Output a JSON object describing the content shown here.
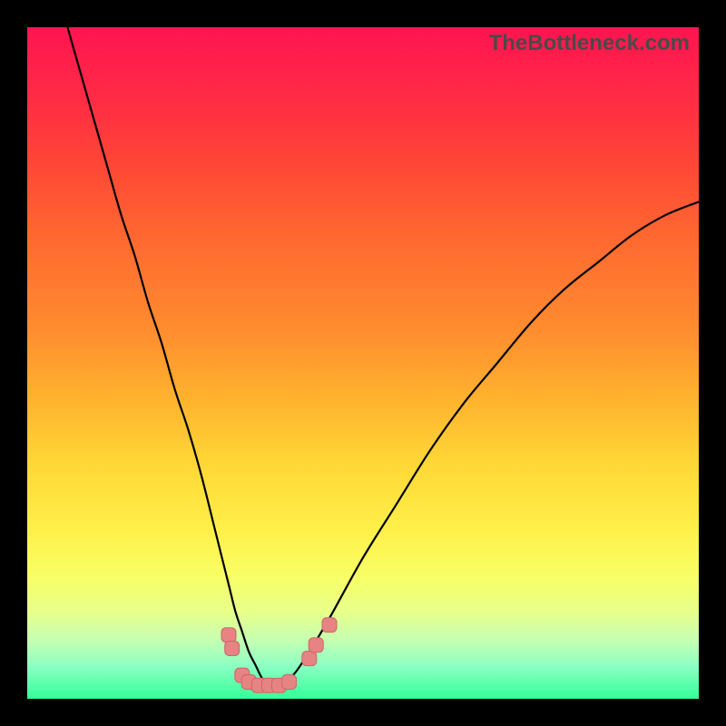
{
  "watermark": "TheBottleneck.com",
  "colors": {
    "frame": "#000000",
    "curve": "#000000",
    "marker_fill": "#e78383",
    "marker_stroke": "#c96868"
  },
  "chart_data": {
    "type": "line",
    "title": "",
    "xlabel": "",
    "ylabel": "",
    "xlim": [
      0,
      100
    ],
    "ylim": [
      0,
      100
    ],
    "series": [
      {
        "name": "bottleneck-curve",
        "x": [
          6,
          8,
          10,
          12,
          14,
          16,
          18,
          20,
          22,
          24,
          26,
          28,
          29,
          30,
          31,
          32,
          33,
          34,
          35,
          36,
          37,
          38,
          39,
          40,
          42,
          45,
          50,
          55,
          60,
          65,
          70,
          75,
          80,
          85,
          90,
          95,
          100
        ],
        "y": [
          100,
          93,
          86,
          79,
          72,
          66,
          59,
          53,
          46,
          40,
          33,
          25,
          21,
          17,
          13,
          10,
          7,
          5,
          3,
          2,
          2,
          2,
          3,
          4,
          7,
          12,
          21,
          29,
          37,
          44,
          50,
          56,
          61,
          65,
          69,
          72,
          74
        ]
      }
    ],
    "markers": [
      {
        "x": 30.0,
        "y": 9.5
      },
      {
        "x": 30.5,
        "y": 7.5
      },
      {
        "x": 32.0,
        "y": 3.5
      },
      {
        "x": 33.0,
        "y": 2.5
      },
      {
        "x": 34.5,
        "y": 2.0
      },
      {
        "x": 36.0,
        "y": 2.0
      },
      {
        "x": 37.5,
        "y": 2.0
      },
      {
        "x": 39.0,
        "y": 2.5
      },
      {
        "x": 42.0,
        "y": 6.0
      },
      {
        "x": 43.0,
        "y": 8.0
      },
      {
        "x": 45.0,
        "y": 11.0
      }
    ]
  }
}
